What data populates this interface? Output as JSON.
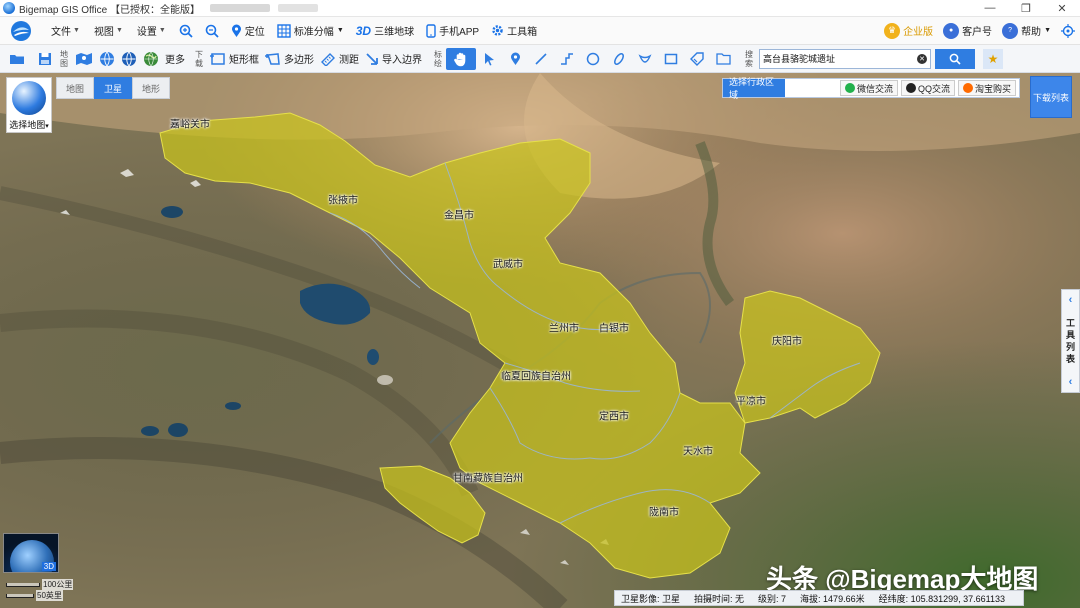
{
  "window": {
    "title": "Bigemap GIS Office 【已授权：全能版】"
  },
  "menu": {
    "items": [
      "文件",
      "视图",
      "设置"
    ],
    "tools": [
      "定位",
      "标准分幅",
      "三维地球",
      "手机APP",
      "工具箱"
    ],
    "tool_3d_glyph": "3D",
    "right": [
      "企业版",
      "客户号",
      "帮助"
    ]
  },
  "toolbar": {
    "map_label": "地图",
    "more": "更多",
    "download_label": "下载",
    "rect_frame": "矩形框",
    "polygon": "多边形",
    "measure": "测距",
    "import_boundary": "导入边界",
    "mark_label": "标绘",
    "search_label": "搜索",
    "search_value": "高台县骆驼城遗址"
  },
  "map": {
    "select_map": "选择地图",
    "tabs": [
      "地图",
      "卫星",
      "地形"
    ],
    "active_tab": "卫星",
    "region_select": "选择行政区域",
    "share": [
      "微信交流",
      "QQ交流",
      "淘宝购买"
    ],
    "download_list": "下载列表",
    "tool_list_chars": [
      "工",
      "具",
      "列",
      "表"
    ],
    "cities": [
      {
        "name": "嘉峪关市"
      },
      {
        "name": "张掖市"
      },
      {
        "name": "金昌市"
      },
      {
        "name": "武威市"
      },
      {
        "name": "兰州市"
      },
      {
        "name": "白银市"
      },
      {
        "name": "临夏回族自治州"
      },
      {
        "name": "定西市"
      },
      {
        "name": "庆阳市"
      },
      {
        "name": "平凉市"
      },
      {
        "name": "天水市"
      },
      {
        "name": "甘南藏族自治州"
      },
      {
        "name": "陇南市"
      }
    ],
    "globe_tag": "3D",
    "scale_1": "100公里",
    "scale_2": "50英里",
    "highlight_color": "#c9c41c"
  },
  "status": {
    "imagery": "卫星影像: 卫星",
    "capture_time": "拍摄时间: 无",
    "level": "级别: 7",
    "altitude": "海拔: 1479.66米",
    "coords": "经纬度: 105.831299, 37.661133"
  },
  "watermark": "头条 @Bigemap大地图"
}
